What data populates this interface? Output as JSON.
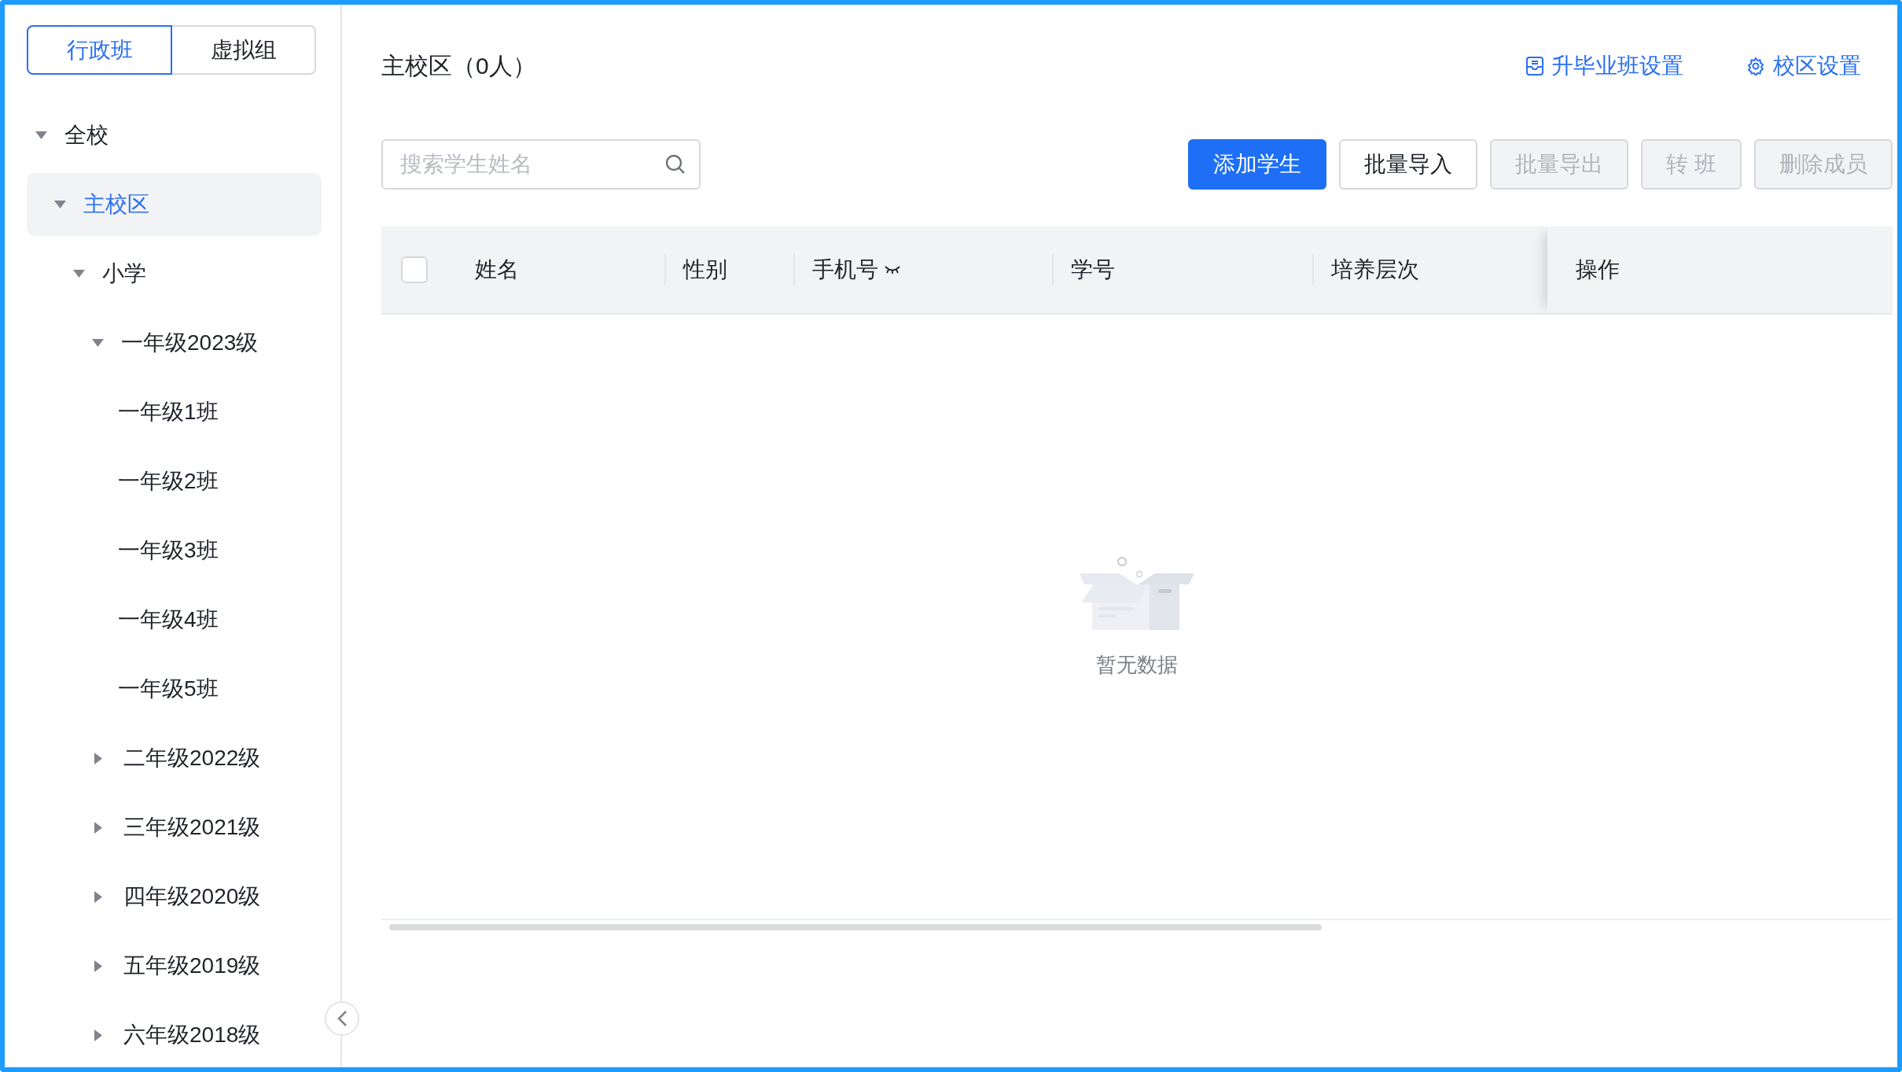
{
  "sidebar": {
    "tabs": [
      {
        "label": "行政班",
        "selected": true
      },
      {
        "label": "虚拟组",
        "selected": false
      }
    ],
    "tree": [
      {
        "label": "全校",
        "expanded": true,
        "selected": false,
        "children": [
          {
            "label": "主校区",
            "expanded": true,
            "selected": true,
            "children": [
              {
                "label": "小学",
                "expanded": true,
                "selected": false,
                "children": [
                  {
                    "label": "一年级2023级",
                    "expanded": true,
                    "selected": false,
                    "children": [
                      {
                        "label": "一年级1班",
                        "selected": false
                      },
                      {
                        "label": "一年级2班",
                        "selected": false
                      },
                      {
                        "label": "一年级3班",
                        "selected": false
                      },
                      {
                        "label": "一年级4班",
                        "selected": false
                      },
                      {
                        "label": "一年级5班",
                        "selected": false
                      }
                    ]
                  },
                  {
                    "label": "二年级2022级",
                    "expanded": false,
                    "selected": false
                  },
                  {
                    "label": "三年级2021级",
                    "expanded": false,
                    "selected": false
                  },
                  {
                    "label": "四年级2020级",
                    "expanded": false,
                    "selected": false
                  },
                  {
                    "label": "五年级2019级",
                    "expanded": false,
                    "selected": false
                  },
                  {
                    "label": "六年级2018级",
                    "expanded": false,
                    "selected": false
                  }
                ]
              }
            ]
          }
        ]
      }
    ]
  },
  "header": {
    "title": "主校区（0人）",
    "links": [
      {
        "kind": "graduation",
        "label": "升毕业班设置"
      },
      {
        "kind": "settings",
        "label": "校区设置"
      }
    ]
  },
  "search": {
    "placeholder": "搜索学生姓名"
  },
  "buttons": [
    {
      "label": "添加学生",
      "kind": "primary",
      "disabled": false
    },
    {
      "label": "批量导入",
      "kind": "default",
      "disabled": false
    },
    {
      "label": "批量导出",
      "kind": "default",
      "disabled": true
    },
    {
      "label": "转 班",
      "kind": "default",
      "disabled": true
    },
    {
      "label": "删除成员",
      "kind": "default",
      "disabled": true
    }
  ],
  "table": {
    "select_all": {
      "checked": false
    },
    "columns": [
      {
        "label": "姓名",
        "masked": false,
        "pinned": false
      },
      {
        "label": "性别",
        "masked": false,
        "pinned": false
      },
      {
        "label": "手机号",
        "masked": true,
        "pinned": false
      },
      {
        "label": "学号",
        "masked": false,
        "pinned": false
      },
      {
        "label": "培养层次",
        "masked": false,
        "pinned": false
      },
      {
        "label": "操作",
        "masked": false,
        "pinned": true
      }
    ],
    "empty_text": "暂无数据"
  }
}
